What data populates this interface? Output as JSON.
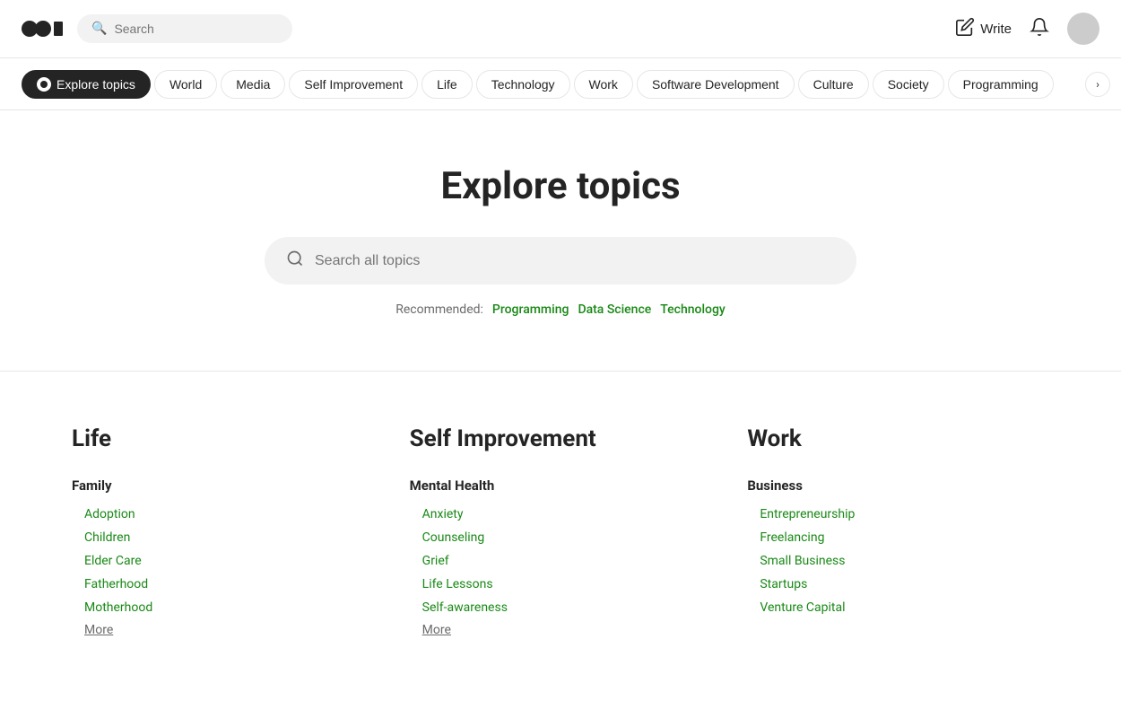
{
  "header": {
    "logo_text": "●●|",
    "search_placeholder": "Search",
    "write_label": "Write",
    "nav_arrow": "›"
  },
  "topic_nav": {
    "items": [
      {
        "id": "explore-topics",
        "label": "Explore topics",
        "active": true,
        "has_icon": true
      },
      {
        "id": "world",
        "label": "World",
        "active": false
      },
      {
        "id": "media",
        "label": "Media",
        "active": false
      },
      {
        "id": "self-improvement",
        "label": "Self Improvement",
        "active": false
      },
      {
        "id": "life",
        "label": "Life",
        "active": false
      },
      {
        "id": "technology",
        "label": "Technology",
        "active": false
      },
      {
        "id": "work",
        "label": "Work",
        "active": false
      },
      {
        "id": "software-development",
        "label": "Software Development",
        "active": false
      },
      {
        "id": "culture",
        "label": "Culture",
        "active": false
      },
      {
        "id": "society",
        "label": "Society",
        "active": false
      },
      {
        "id": "programming",
        "label": "Programming",
        "active": false
      }
    ]
  },
  "hero": {
    "title": "Explore topics",
    "search_placeholder": "Search all topics",
    "recommended_label": "Recommended:",
    "recommended_tags": [
      "Programming",
      "Data Science",
      "Technology"
    ]
  },
  "categories": [
    {
      "id": "life",
      "title": "Life",
      "subcategories": [
        {
          "title": "Family",
          "items": [
            "Adoption",
            "Children",
            "Elder Care",
            "Fatherhood",
            "Motherhood"
          ],
          "more_label": "More"
        }
      ]
    },
    {
      "id": "self-improvement",
      "title": "Self Improvement",
      "subcategories": [
        {
          "title": "Mental Health",
          "items": [
            "Anxiety",
            "Counseling",
            "Grief",
            "Life Lessons",
            "Self-awareness"
          ],
          "more_label": "More"
        }
      ]
    },
    {
      "id": "work",
      "title": "Work",
      "subcategories": [
        {
          "title": "Business",
          "items": [
            "Entrepreneurship",
            "Freelancing",
            "Small Business",
            "Startups",
            "Venture Capital"
          ],
          "more_label": null
        }
      ]
    }
  ],
  "colors": {
    "active_bg": "#242424",
    "link_green": "#1a8917",
    "border": "#e6e6e6",
    "muted": "#6b6b6b"
  }
}
